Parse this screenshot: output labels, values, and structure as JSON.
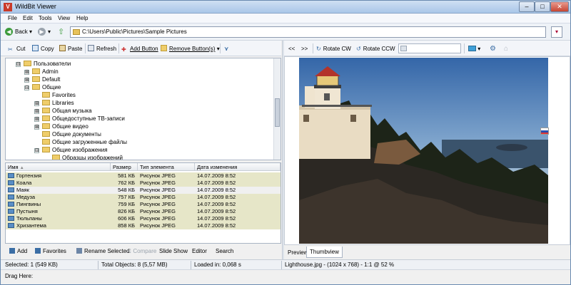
{
  "window": {
    "title": "WildBit Viewer",
    "icon": "V",
    "min": "–",
    "max": "□",
    "close": "✕"
  },
  "menu": [
    "File",
    "Edit",
    "Tools",
    "View",
    "Help"
  ],
  "address": {
    "back": "Back",
    "path": "C:\\Users\\Public\\Pictures\\Sample Pictures"
  },
  "toolbar": {
    "cut": "Cut",
    "copy": "Copy",
    "paste": "Paste",
    "refresh": "Refresh",
    "add_button": "Add Button",
    "remove_button": "Remove Button(s)"
  },
  "tree": [
    {
      "label": "Пользователи",
      "expander": "⊟",
      "folder": true
    },
    {
      "label": "Admin",
      "expander": "⊞",
      "folder": true
    },
    {
      "label": "Default",
      "expander": "⊞",
      "folder": true
    },
    {
      "label": "Общие",
      "expander": "⊟",
      "folder": true
    },
    {
      "label": "Favorites",
      "expander": "",
      "folder": true
    },
    {
      "label": "Libraries",
      "expander": "⊞",
      "folder": true
    },
    {
      "label": "Общая музыка",
      "expander": "⊞",
      "folder": true
    },
    {
      "label": "Общедоступные ТВ-записи",
      "expander": "⊞",
      "folder": true
    },
    {
      "label": "Общие видео",
      "expander": "⊞",
      "folder": true
    },
    {
      "label": "Общие документы",
      "expander": "",
      "folder": true
    },
    {
      "label": "Общие загруженные файлы",
      "expander": "",
      "folder": true
    },
    {
      "label": "Общие изображения",
      "expander": "⊟",
      "folder": true
    },
    {
      "label": "Образцы изображений",
      "expander": "",
      "folder": true
    }
  ],
  "filelist": {
    "columns": [
      "Имя",
      "Размер",
      "Тип элемента",
      "Дата изменения"
    ],
    "sort_arrow": "▲",
    "rows": [
      {
        "name": "Гортензия",
        "size": "581 КБ",
        "type": "Рисунок JPEG",
        "date": "14.07.2009 8:52"
      },
      {
        "name": "Коала",
        "size": "762 КБ",
        "type": "Рисунок JPEG",
        "date": "14.07.2009 8:52"
      },
      {
        "name": "Маяк",
        "size": "548 КБ",
        "type": "Рисунок JPEG",
        "date": "14.07.2009 8:52"
      },
      {
        "name": "Медуза",
        "size": "757 КБ",
        "type": "Рисунок JPEG",
        "date": "14.07.2009 8:52"
      },
      {
        "name": "Пингвины",
        "size": "759 КБ",
        "type": "Рисунок JPEG",
        "date": "14.07.2009 8:52"
      },
      {
        "name": "Пустыня",
        "size": "826 КБ",
        "type": "Рисунок JPEG",
        "date": "14.07.2009 8:52"
      },
      {
        "name": "Тюльпаны",
        "size": "606 КБ",
        "type": "Рисунок JPEG",
        "date": "14.07.2009 8:52"
      },
      {
        "name": "Хризантема",
        "size": "858 КБ",
        "type": "Рисунок JPEG",
        "date": "14.07.2009 8:52"
      }
    ]
  },
  "actions": {
    "add": "Add",
    "favorites": "Favorites",
    "rename": "Rename Selected",
    "compare": "Compare",
    "slideshow": "Slide Show",
    "editor": "Editor",
    "search": "Search"
  },
  "right_toolbar": {
    "prev": "<<",
    "next": ">>",
    "rotate_cw": "Rotate CW",
    "rotate_ccw": "Rotate CCW"
  },
  "tabs": {
    "preview": "Preview",
    "thumbview": "Thumbview"
  },
  "status": {
    "selected": "Selected: 1 (549 KB)",
    "total": "Total Objects: 8 (5,57 MB)",
    "loaded": "Loaded in: 0,068 s",
    "fileinfo": "Lighthouse.jpg - (1024 x 768) - 1:1 @ 52  %"
  },
  "drag_label": "Drag Here:",
  "colors": {
    "accent": "#3b6ea5",
    "row_highlight": "#e6e6c8",
    "selected_row": "#f0f0f0"
  }
}
